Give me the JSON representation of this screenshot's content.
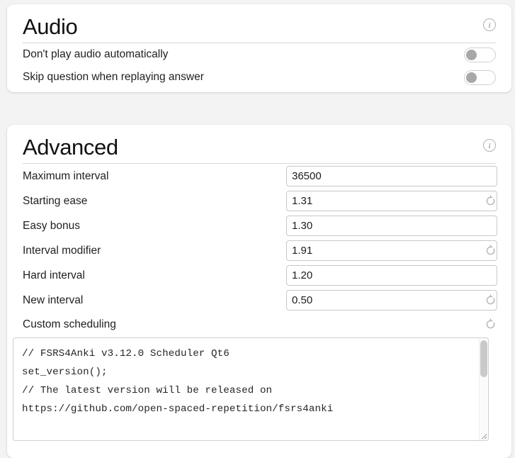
{
  "audio": {
    "title": "Audio",
    "info_icon": "info-icon",
    "toggles": [
      {
        "label": "Don't play audio automatically",
        "state": "off"
      },
      {
        "label": "Skip question when replaying answer",
        "state": "off"
      }
    ]
  },
  "advanced": {
    "title": "Advanced",
    "info_icon": "info-icon",
    "settings": [
      {
        "label": "Maximum interval",
        "value": "36500",
        "revert": false
      },
      {
        "label": "Starting ease",
        "value": "1.31",
        "revert": true
      },
      {
        "label": "Easy bonus",
        "value": "1.30",
        "revert": false
      },
      {
        "label": "Interval modifier",
        "value": "1.91",
        "revert": true
      },
      {
        "label": "Hard interval",
        "value": "1.20",
        "revert": false
      },
      {
        "label": "New interval",
        "value": "0.50",
        "revert": true
      }
    ],
    "custom_scheduling": {
      "label": "Custom scheduling",
      "revert": true,
      "code": "// FSRS4Anki v3.12.0 Scheduler Qt6\nset_version();\n// The latest version will be released on\nhttps://github.com/open-spaced-repetition/fsrs4anki"
    }
  },
  "colors": {
    "page_background": "#f3f3f3",
    "card_background": "#ffffff",
    "text": "#1f1f1f",
    "border": "#c8c8c8",
    "toggle_knob": "#a8a8a8",
    "muted_icon": "#9a9a9a"
  }
}
